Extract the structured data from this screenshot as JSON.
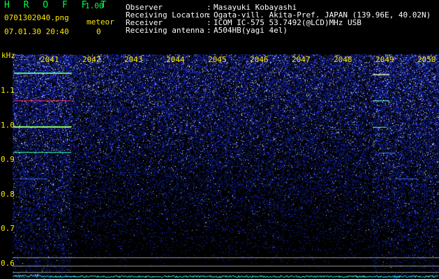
{
  "app": {
    "title": "H R O F F T",
    "version": "1.00"
  },
  "file": {
    "name": "0701302040.png",
    "datetime": "07.01.30 20:40"
  },
  "meteor": {
    "label": "meteor",
    "count": "0"
  },
  "station": {
    "rows": [
      {
        "label": "Observer",
        "value": "Masayuki Kobayashi"
      },
      {
        "label": "Receiving Location",
        "value": "Ogata-vill. Akita-Pref. JAPAN (139.96E, 40.02N)"
      },
      {
        "label": "Receiver",
        "value": "ICOM IC-575 53.7492(@LCD)MHz USB"
      },
      {
        "label": "Receiving antenna",
        "value": "A504HB(yagi 4el)"
      }
    ],
    "separator": ":"
  },
  "axis": {
    "unit": "kHz",
    "x_ticks": [
      "2041",
      "2042",
      "2043",
      "2044",
      "2045",
      "2046",
      "2047",
      "2048",
      "2049",
      "2050"
    ],
    "y_ticks": [
      "1.1",
      "1.0",
      "0.9",
      "0.8",
      "0.7",
      "0.6"
    ]
  },
  "colors": {
    "background": "#000000",
    "label": "#ffe800",
    "text": "#ffffff",
    "title": "#00ff44",
    "noise": "#1c2cff",
    "spectrum": "#33ffff"
  }
}
